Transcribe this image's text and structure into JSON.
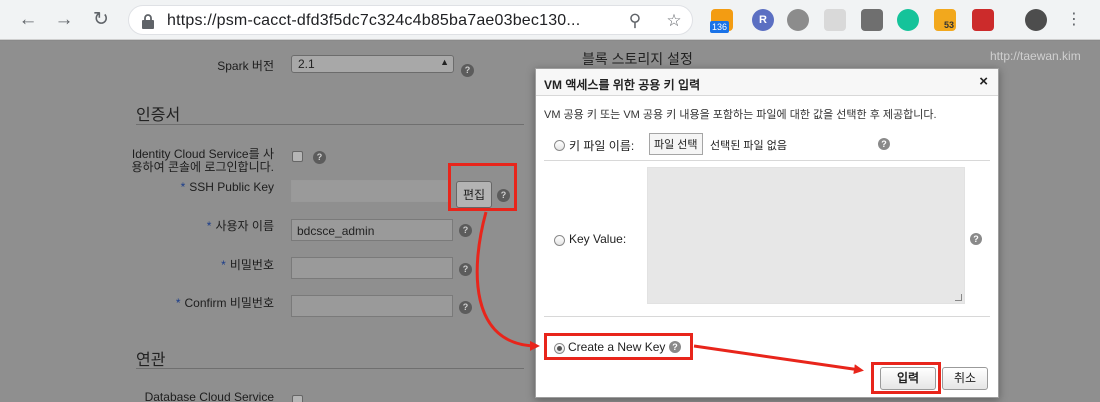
{
  "browser": {
    "url": "https://psm-cacct-dfd3f5dc7c324c4b85ba7ae03bec130...",
    "extension_badge": "136",
    "extension_badge2": "53",
    "icons": [
      "back-icon",
      "forward-icon",
      "reload-icon",
      "lock-icon",
      "zoom-icon",
      "star-icon",
      "rss-icon",
      "r-extension-icon",
      "gear-extension-icon",
      "screen-icon",
      "camera-icon",
      "grammarly-icon",
      "puzzle-extension-icon",
      "bookmark-extension-icon",
      "avatar-icon",
      "kebab-menu-icon"
    ]
  },
  "watermark": "http://taewan.kim",
  "form": {
    "spark_label": "Spark 버전",
    "spark_value": "2.1",
    "cert_section": "인증서",
    "idcs_label_1": "Identity Cloud Service를 사",
    "idcs_label_2": "용하여 콘솔에 로그인합니다.",
    "ssh_label": "SSH Public Key",
    "edit_button": "편집",
    "user_label": "사용자 이름",
    "user_value": "bdcsce_admin",
    "password_label": "비밀번호",
    "confirm_label": "Confirm 비밀번호",
    "related_section": "연관",
    "db_label": "Database Cloud Service",
    "required_mark": "*",
    "help_glyph": "?"
  },
  "block_storage_title": "블록 스토리지 설정",
  "modal": {
    "title": "VM 액세스를 위한 공용 키 입력",
    "close": "×",
    "description": "VM 공용 키 또는 VM 공용 키 내용을 포함하는 파일에 대한 값을 선택한 후 제공합니다.",
    "key_file_label": "키 파일 이름:",
    "file_button": "파일 선택",
    "file_none": "선택된 파일 없음",
    "key_value_label": "Key Value:",
    "create_key_label": "Create a New Key",
    "submit": "입력",
    "cancel": "취소"
  },
  "colors": {
    "highlight": "#e8251b",
    "overlay": "#8f8f8f"
  }
}
